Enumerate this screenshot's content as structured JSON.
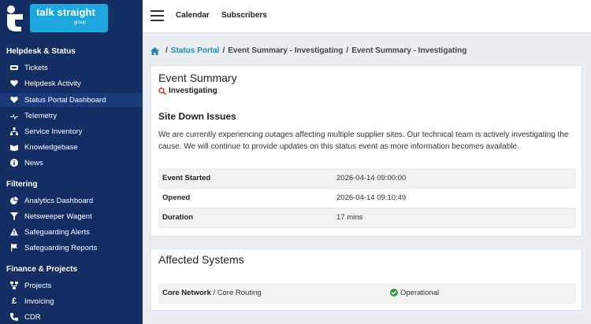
{
  "brand": {
    "name": "talk straight",
    "sub": "group",
    "primary": "#142d63",
    "accent": "#1ea6df"
  },
  "topbar": {
    "links": [
      "Calendar",
      "Subscribers"
    ]
  },
  "sidebar": {
    "sections": [
      {
        "title": "Helpdesk & Status",
        "items": [
          {
            "label": "Tickets",
            "icon": "ticket-icon"
          },
          {
            "label": "Helpdesk Activity",
            "icon": "heartbeat-icon"
          },
          {
            "label": "Status Portal Dashboard",
            "icon": "heartbeat-icon",
            "active": true
          },
          {
            "label": "Telemetry",
            "icon": "telemetry-icon"
          },
          {
            "label": "Service Inventory",
            "icon": "sitemap-icon"
          },
          {
            "label": "Knowledgebase",
            "icon": "knowledgebase-icon"
          },
          {
            "label": "News",
            "icon": "info-icon"
          }
        ]
      },
      {
        "title": "Filtering",
        "items": [
          {
            "label": "Analytics Dashboard",
            "icon": "pie-chart-icon"
          },
          {
            "label": "Netsweeper Wagent",
            "icon": "filter-icon"
          },
          {
            "label": "Safeguarding Alerts",
            "icon": "warning-icon"
          },
          {
            "label": "Safeguarding Reports",
            "icon": "flag-icon"
          }
        ]
      },
      {
        "title": "Finance & Projects",
        "items": [
          {
            "label": "Projects",
            "icon": "projects-icon"
          },
          {
            "label": "Invoicing",
            "icon": "pound-icon"
          },
          {
            "label": "CDR",
            "icon": "phone-icon"
          }
        ]
      }
    ]
  },
  "breadcrumb": {
    "link": "Status Portal",
    "items": [
      "Event Summary - Investigating",
      "Event Summary - Investigating"
    ]
  },
  "event": {
    "title": "Event Summary",
    "status": "Investigating",
    "issue_title": "Site Down Issues",
    "description": "We are currently experiencing outages affecting multiple supplier sites. Our technical team is actively investigating the cause. We will continue to provide updates on this status event as more information becomes available.",
    "details": [
      {
        "key": "Event Started",
        "value": "2026-04-14 09:00:00"
      },
      {
        "key": "Opened",
        "value": "2026-04-14 09:10:49"
      },
      {
        "key": "Duration",
        "value": "17 mins"
      }
    ]
  },
  "affected": {
    "title": "Affected Systems",
    "systems": [
      {
        "group": "Core Network",
        "sep": " / ",
        "name": "Core Routing",
        "status": "Operational"
      }
    ]
  },
  "colors": {
    "link": "#2a86a8",
    "operational": "#3a9b45",
    "investigating": "#c0392b"
  }
}
